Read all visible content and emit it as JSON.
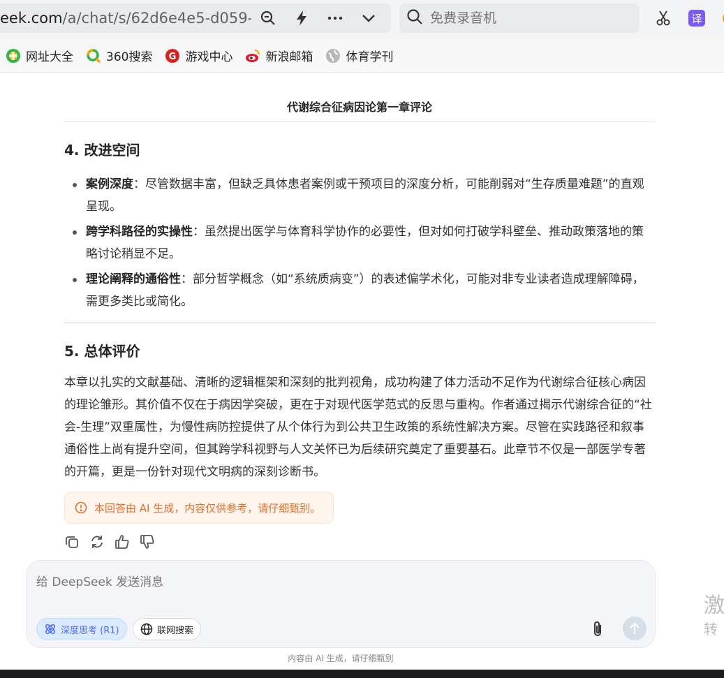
{
  "browser": {
    "url_host": "eek.com",
    "url_path": "/a/chat/s/62d6e4e5-d059-4",
    "search_placeholder": "免费录音机",
    "translate_label": "译"
  },
  "bookmarks": [
    {
      "label": "网址大全",
      "icon": "globe-green-icon"
    },
    {
      "label": "360搜索",
      "icon": "search-360-icon"
    },
    {
      "label": "游戏中心",
      "icon": "game-icon"
    },
    {
      "label": "新浪邮箱",
      "icon": "sina-icon"
    },
    {
      "label": "体育学刊",
      "icon": "globe-gray-icon"
    }
  ],
  "document": {
    "title": "代谢综合征病因论第一章评论",
    "section4": {
      "heading": "4. 改进空间",
      "items": [
        {
          "bold": "案例深度",
          "text": "：尽管数据丰富，但缺乏具体患者案例或干预项目的深度分析，可能削弱对“生存质量难题”的直观呈现。"
        },
        {
          "bold": "跨学科路径的实操性",
          "text": "：虽然提出医学与体育科学协作的必要性，但对如何打破学科壁垒、推动政策落地的策略讨论稍显不足。"
        },
        {
          "bold": "理论阐释的通俗性",
          "text": "：部分哲学概念（如“系统质病变”）的表述偏学术化，可能对非专业读者造成理解障碍，需更多类比或简化。"
        }
      ]
    },
    "section5": {
      "heading": "5. 总体评价",
      "paragraph": "本章以扎实的文献基础、清晰的逻辑框架和深刻的批判视角，成功构建了体力活动不足作为代谢综合征核心病因的理论雏形。其价值不仅在于病因学突破，更在于对现代医学范式的反思与重构。作者通过揭示代谢综合征的“社会-生理”双重属性，为慢性病防控提供了从个体行为到公共卫生政策的系统性解决方案。尽管在实践路径和叙事通俗性上尚有提升空间，但其跨学科视野与人文关怀已为后续研究奠定了重要基石。此章节不仅是一部医学专著的开篇，更是一份针对现代文明病的深刻诊断书。"
    },
    "warning": "本回答由 AI 生成，内容仅供参考，请仔细甄别。"
  },
  "composer": {
    "placeholder": "给 DeepSeek 发送消息",
    "deep_think_label": "深度思考 (R1)",
    "web_search_label": "联网搜索"
  },
  "footnote": "内容由 AI 生成，请仔细甄别",
  "side_text": {
    "a": "激",
    "b": "转"
  },
  "colors": {
    "accent": "#4d6bfe",
    "warning": "#e46f2a"
  }
}
